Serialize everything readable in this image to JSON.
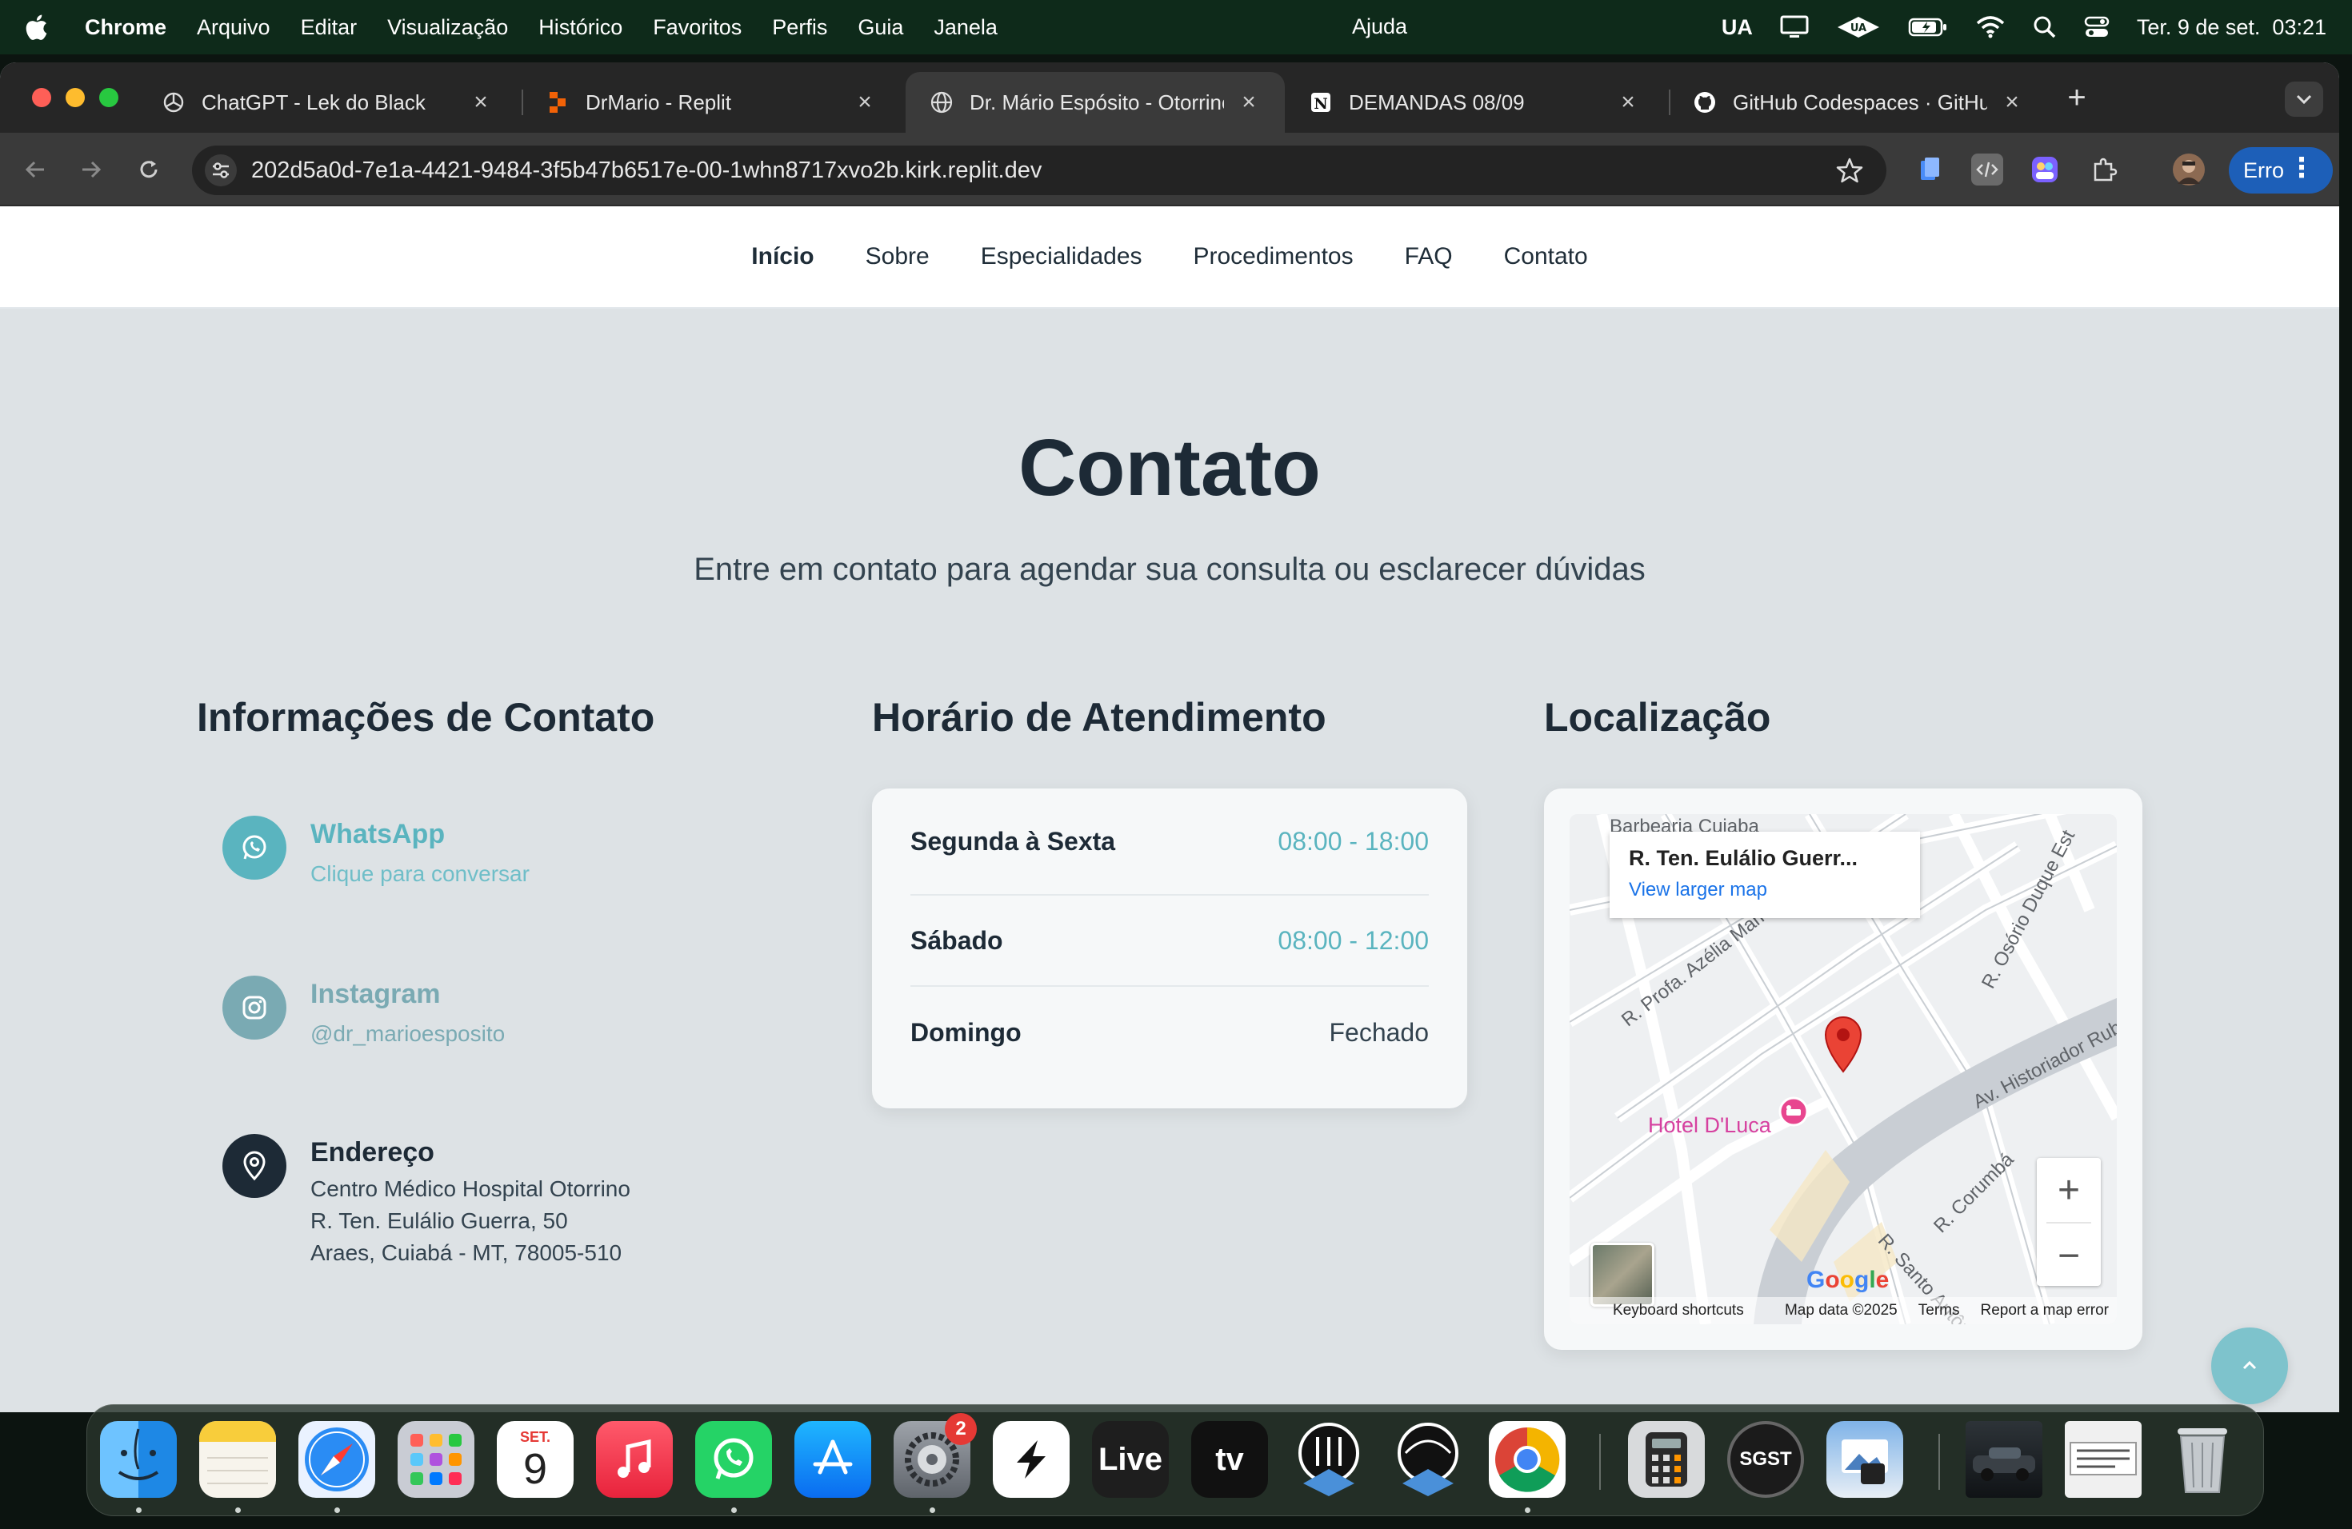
{
  "menubar": {
    "app": "Chrome",
    "items": [
      "Arquivo",
      "Editar",
      "Visualização",
      "Histórico",
      "Favoritos",
      "Perfis",
      "Guia",
      "Janela"
    ],
    "help": "Ajuda",
    "input_source": "UA",
    "datetime": "Ter. 9 de set.  03:21"
  },
  "browser": {
    "tabs": [
      {
        "title": "ChatGPT - Lek do Black",
        "icon": "openai-icon"
      },
      {
        "title": "DrMario - Replit",
        "icon": "replit-icon"
      },
      {
        "title": "Dr. Mário Espósito - Otorrinol",
        "icon": "globe-icon",
        "active": true
      },
      {
        "title": "DEMANDAS 08/09",
        "icon": "notion-icon"
      },
      {
        "title": "GitHub Codespaces · GitHub",
        "icon": "github-icon"
      }
    ],
    "url": "202d5a0d-7e1a-4421-9484-3f5b47b6517e-00-1whn8717xvo2b.kirk.replit.dev",
    "profile_status": "Erro"
  },
  "site": {
    "nav": [
      "Início",
      "Sobre",
      "Especialidades",
      "Procedimentos",
      "FAQ",
      "Contato"
    ],
    "title": "Contato",
    "subtitle": "Entre em contato para agendar sua consulta ou esclarecer dúvidas",
    "contact_info": {
      "heading": "Informações de Contato",
      "whatsapp": {
        "label": "WhatsApp",
        "sub": "Clique para conversar"
      },
      "instagram": {
        "label": "Instagram",
        "sub": "@dr_marioesposito"
      },
      "address": {
        "label": "Endereço",
        "line1": "Centro Médico Hospital Otorrino",
        "line2": "R. Ten. Eulálio Guerra, 50",
        "line3": "Araes, Cuiabá - MT, 78005-510"
      }
    },
    "hours": {
      "heading": "Horário de Atendimento",
      "rows": [
        {
          "day": "Segunda à Sexta",
          "time": "08:00 - 18:00"
        },
        {
          "day": "Sábado",
          "time": "08:00 - 12:00"
        },
        {
          "day": "Domingo",
          "time": "Fechado"
        }
      ]
    },
    "location": {
      "heading": "Localização",
      "popup_title": "R. Ten. Eulálio Guerr...",
      "popup_link": "View larger map",
      "labels": {
        "barbearia": "Barbearia Cuiaba",
        "azelia": "R. Profa. Azélia Mamoré de M",
        "osorio": "R. Osório Duque Est",
        "historiador": "Av. Historiador Rub",
        "corumba": "R. Corumbá",
        "santo": "R. Santo Antôn",
        "hotel": "Hotel D'Luca"
      },
      "google": "Google",
      "footer": [
        "Keyboard shortcuts",
        "Map data ©2025",
        "Terms",
        "Report a map error"
      ],
      "zoom_in": "+",
      "zoom_out": "−"
    }
  },
  "dock": {
    "calendar_month": "SET.",
    "calendar_day": "9",
    "settings_badge": "2",
    "live_label": "Live",
    "tv_label": "tv",
    "sgst_label": "SGST"
  }
}
